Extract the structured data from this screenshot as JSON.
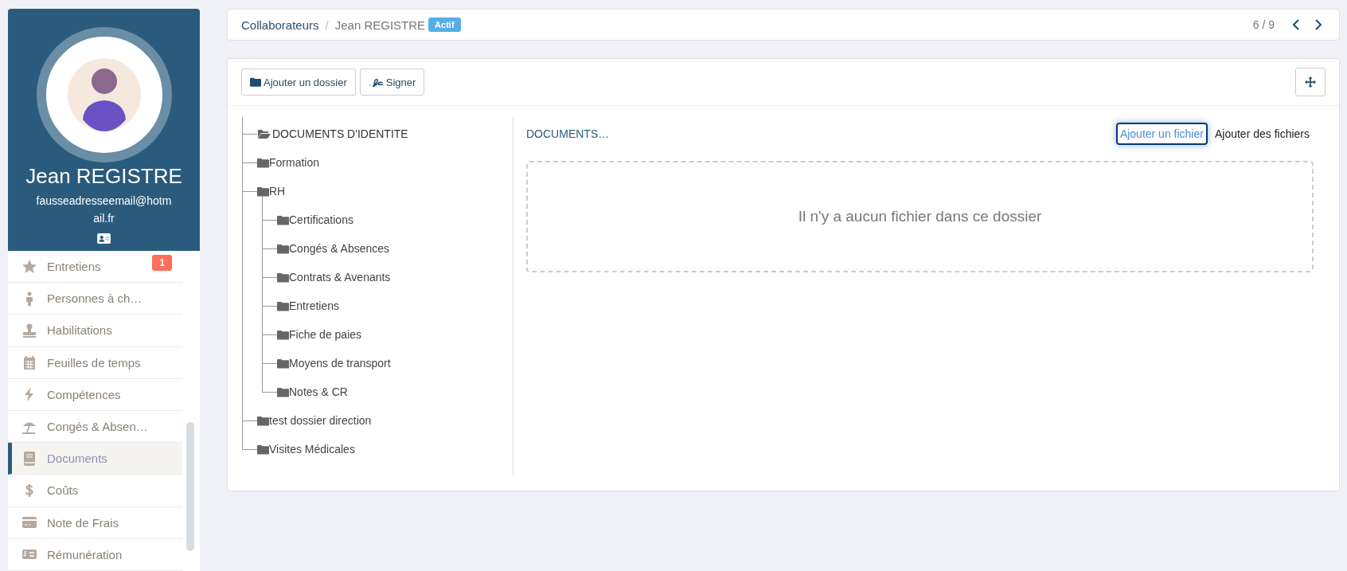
{
  "profile": {
    "name": "Jean REGISTRE",
    "email": "fausseadresseemail@hotmail.fr"
  },
  "sidebar": {
    "items": [
      {
        "label": "Entretiens",
        "selected": false,
        "badge": "1",
        "color": "#fd6e5c"
      },
      {
        "label": "Personnes à ch…",
        "selected": false
      },
      {
        "label": "Habilitations",
        "selected": false
      },
      {
        "label": "Feuilles de temps",
        "selected": false
      },
      {
        "label": "Compétences",
        "selected": false
      },
      {
        "label": "Congés & Absen…",
        "selected": false
      },
      {
        "label": "Documents",
        "selected": true
      },
      {
        "label": "Coûts",
        "selected": false
      },
      {
        "label": "Note de Frais",
        "selected": false
      },
      {
        "label": "Rémunération",
        "selected": false
      }
    ]
  },
  "breadcrumb": {
    "items": [
      "Collaborateurs",
      "Jean REGISTRE"
    ],
    "separator": "/",
    "status": "Actif",
    "pager": "6 / 9"
  },
  "toolbar": {
    "buttons": [
      "Ajouter un dossier",
      "Signer"
    ]
  },
  "tree": [
    {
      "label": "DOCUMENTS D'IDENTITE",
      "selected": true
    },
    {
      "label": "Formation",
      "selected": false
    },
    {
      "label": "RH",
      "selected": false,
      "children": [
        {
          "label": "Certifications",
          "selected": false
        },
        {
          "label": "Congés & Absences",
          "selected": false
        },
        {
          "label": "Contrats & Avenants",
          "selected": false
        },
        {
          "label": "Entretiens",
          "selected": false
        },
        {
          "label": "Fiche de paies",
          "selected": false
        },
        {
          "label": "Moyens de transport",
          "selected": false
        },
        {
          "label": "Notes & CR",
          "selected": false
        }
      ]
    },
    {
      "label": "test dossier direction",
      "selected": false
    },
    {
      "label": "Visites Médicales",
      "selected": false
    }
  ],
  "folder": {
    "title": "DOCUMENTS…",
    "actions": [
      {
        "label": "Ajouter un fichier",
        "focused": true
      },
      {
        "label": "Ajouter des fichiers",
        "focused": false
      }
    ],
    "empty_message": "Il n'y a aucun fichier dans ce dossier"
  }
}
